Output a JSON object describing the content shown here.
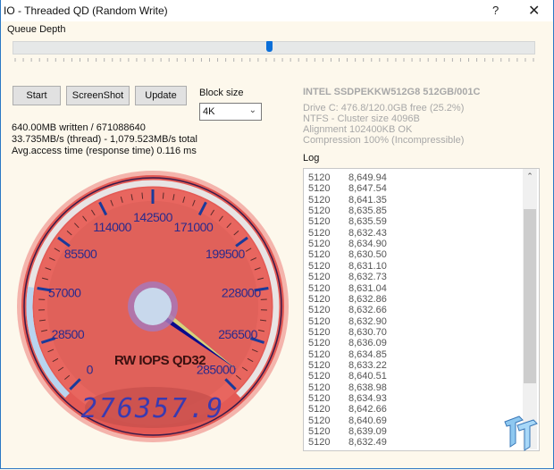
{
  "window": {
    "title": "IO - Threaded QD (Random Write)",
    "help_label": "?",
    "close_label": "✕"
  },
  "queue_depth": {
    "label": "Queue Depth",
    "slider_value_fraction": 0.5
  },
  "buttons": {
    "start": "Start",
    "screenshot": "ScreenShot",
    "update": "Update"
  },
  "block_size": {
    "label": "Block size",
    "selected": "4K",
    "chevron_icon": "chevron-down-icon"
  },
  "stats": {
    "written": "640.00MB written / 671088640",
    "speed": "33.735MB/s (thread) - 1,079.523MB/s total",
    "access_time": "Avg.access time (response time) 0.116 ms"
  },
  "drive": {
    "name": "INTEL SSDPEKKW512G8 512GB/001C",
    "info": [
      "Drive C: 476.8/120.0GB free (25.2%)",
      "NTFS - Cluster size 4096B",
      "Alignment 102400KB OK",
      "Compression 100% (Incompressible)"
    ]
  },
  "log": {
    "label": "Log",
    "rows": [
      [
        "5120",
        "8,649.94"
      ],
      [
        "5120",
        "8,647.54"
      ],
      [
        "5120",
        "8,641.35"
      ],
      [
        "5120",
        "8,635.85"
      ],
      [
        "5120",
        "8,635.59"
      ],
      [
        "5120",
        "8,632.43"
      ],
      [
        "5120",
        "8,634.90"
      ],
      [
        "5120",
        "8,630.50"
      ],
      [
        "5120",
        "8,631.10"
      ],
      [
        "5120",
        "8,632.73"
      ],
      [
        "5120",
        "8,631.04"
      ],
      [
        "5120",
        "8,632.86"
      ],
      [
        "5120",
        "8,632.66"
      ],
      [
        "5120",
        "8,632.90"
      ],
      [
        "5120",
        "8,630.70"
      ],
      [
        "5120",
        "8,636.09"
      ],
      [
        "5120",
        "8,634.85"
      ],
      [
        "5120",
        "8,633.22"
      ],
      [
        "5120",
        "8,640.51"
      ],
      [
        "5120",
        "8,638.98"
      ],
      [
        "5120",
        "8,634.93"
      ],
      [
        "5120",
        "8,642.66"
      ],
      [
        "5120",
        "8,640.69"
      ],
      [
        "5120",
        "8,639.09"
      ],
      [
        "5120",
        "8,632.49"
      ]
    ],
    "scroll_up_icon": "chevron-up-icon"
  },
  "gauge": {
    "title": "RW IOPS QD32",
    "min": 0,
    "max": 285000,
    "tick_labels": [
      "0",
      "28500",
      "57000",
      "85500",
      "114000",
      "142500",
      "171000",
      "199500",
      "228000",
      "256500",
      "285000"
    ],
    "value": 276357.9,
    "readout": "276357.9",
    "colors": {
      "face": "#e8675f",
      "labels": "#2a2a8c",
      "needle": "#0a0a8c",
      "needle_highlight": "#f0e878",
      "hub": "#c8d8ec"
    }
  },
  "watermark": "tweaktown-logo"
}
